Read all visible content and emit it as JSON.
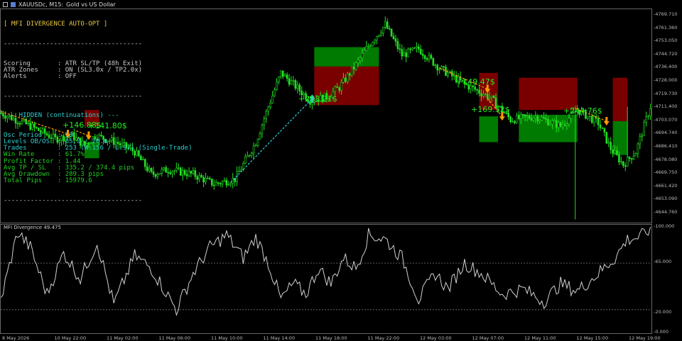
{
  "header": {
    "symbol": "XAUUSDc, M15:",
    "description": "Gold vs US Dollar"
  },
  "panel": {
    "title": "[ MFI DIVERGENCE AUTO-OPT ]",
    "separator": "------------------------------------",
    "rows": [
      {
        "k": "Scoring",
        "v": ": ATR SL/TP (48h Exit)"
      },
      {
        "k": "ATR Zones",
        "v": ": ON (SL3.0x / TP2.0x)"
      },
      {
        "k": "Alerts",
        "v": ": OFF"
      }
    ],
    "hidden_title": "--- HIDDEN (continuations) ---",
    "stats": [
      {
        "k": "Osc Period",
        "v": ": 10",
        "c": "cy"
      },
      {
        "k": "Levels OB/OS",
        "v": ": 65.0 / 20.0",
        "c": "cy"
      },
      {
        "k": "Trades",
        "v": ": 253 (W:156 / L:97) (Single-Trade)",
        "c": "cy"
      },
      {
        "k": "Win Rate",
        "v": ": 61.7%",
        "c": "gr"
      },
      {
        "k": "Profit Factor",
        "v": ": 1.44",
        "c": "gr"
      },
      {
        "k": "Avg TP / SL",
        "v": ": 335.2 / 374.4 pips",
        "c": "gr"
      },
      {
        "k": "Avg Drawdown",
        "v": ": 289.3 pips",
        "c": "gr"
      },
      {
        "k": "Total Pips",
        "v": ": 15979.6",
        "c": "gr"
      }
    ]
  },
  "trade_labels": [
    {
      "text": "+146.88$"
    },
    {
      "text": "+141.80$"
    },
    {
      "text": "+253.21$"
    },
    {
      "text": "+149.47$"
    },
    {
      "text": "+169.52$"
    },
    {
      "text": "+244.76$"
    }
  ],
  "oscillator": {
    "title": "MFI Divergence 49.475",
    "ticks": [
      "100.000",
      "65.000",
      "20.000",
      "0.000"
    ],
    "levels": [
      65,
      20
    ]
  },
  "price_axis": [
    "4769.710",
    "4761.360",
    "4753.050",
    "4744.720",
    "4736.400",
    "4728.000",
    "4719.730",
    "4711.400",
    "4703.070",
    "4694.740",
    "4686.410",
    "4678.080",
    "4669.750",
    "4661.420",
    "4653.090",
    "4644.760"
  ],
  "time_axis": [
    "8 May 2026",
    "10 May 22:00",
    "11 May 02:00",
    "11 May 06:00",
    "11 May 10:00",
    "11 May 14:00",
    "11 May 18:00",
    "11 May 22:00",
    "12 May 03:00",
    "12 May 07:00",
    "12 May 11:00",
    "12 May 15:00",
    "12 May 19:00"
  ],
  "chart_data": {
    "type": "candlestick",
    "y_range": [
      4640,
      4773
    ],
    "colors": {
      "bull": "#21e021",
      "bear": "#21e021",
      "tp_zone": "#007a00",
      "sl_zone": "#7a0000",
      "bull_signal": "#2ad0e0",
      "bear_signal": "#ff9900"
    },
    "zones": [
      {
        "x0": 40,
        "x1": 47,
        "tp": [
          4690,
          4680
        ],
        "sl": [
          4700,
          4710
        ]
      },
      {
        "x0": 150,
        "x1": 181,
        "tp": [
          4737,
          4749
        ],
        "sl": [
          4713,
          4737
        ]
      },
      {
        "x0": 229,
        "x1": 238,
        "tp": [
          4706,
          4690
        ],
        "sl": [
          4710,
          4733
        ]
      },
      {
        "x0": 248,
        "x1": 276,
        "tp": [
          4707,
          4690
        ],
        "sl": [
          4710,
          4730
        ]
      },
      {
        "x0": 293,
        "x1": 300,
        "tp": [
          4703,
          4682
        ],
        "sl": [
          4703,
          4730
        ]
      }
    ],
    "signals": [
      {
        "x": 32,
        "price": 4695,
        "dir": "down",
        "from_x": 0,
        "from_price": 4709
      },
      {
        "x": 42,
        "price": 4694,
        "dir": "down",
        "from_x": 36,
        "from_price": 4697
      },
      {
        "x": 149,
        "price": 4717,
        "dir": "up",
        "from_x": 110,
        "from_price": 4665
      },
      {
        "x": 233,
        "price": 4723,
        "dir": "down",
        "from_x": 210,
        "from_price": 4736
      },
      {
        "x": 240,
        "price": 4706,
        "dir": "down",
        "from_x": 233,
        "from_price": 4717
      },
      {
        "x": 290,
        "price": 4703,
        "dir": "down",
        "from_x": 275,
        "from_price": 4711
      }
    ]
  }
}
